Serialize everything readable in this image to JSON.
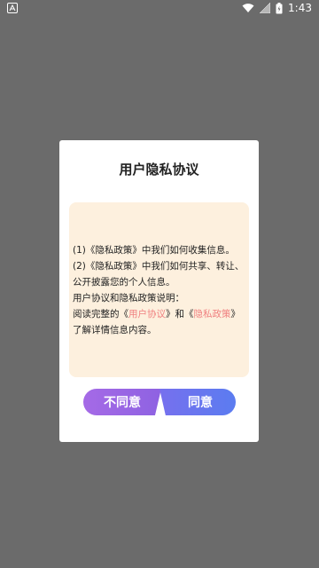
{
  "status_bar": {
    "time": "1:43"
  },
  "dialog": {
    "title": "用户隐私协议",
    "content": {
      "line1": "(1)《隐私政策》中我们如何收集信息。",
      "line2": "(2)《隐私政策》中我们如何共享、转让、公开披露您的个人信息。",
      "line3": "用户协议和隐私政策说明：",
      "line4_prefix": "阅读完整的《",
      "user_agreement_link": "用户协议",
      "line4_middle": "》和《",
      "privacy_policy_link": "隐私政策",
      "line4_suffix": "》了解详情信息内容。"
    },
    "buttons": {
      "disagree": "不同意",
      "agree": "同意"
    }
  },
  "colors": {
    "link": "#f08080",
    "content_bg": "#fdf0de",
    "disagree_btn": "#9a66e4",
    "agree_btn": "#6a78ef"
  }
}
